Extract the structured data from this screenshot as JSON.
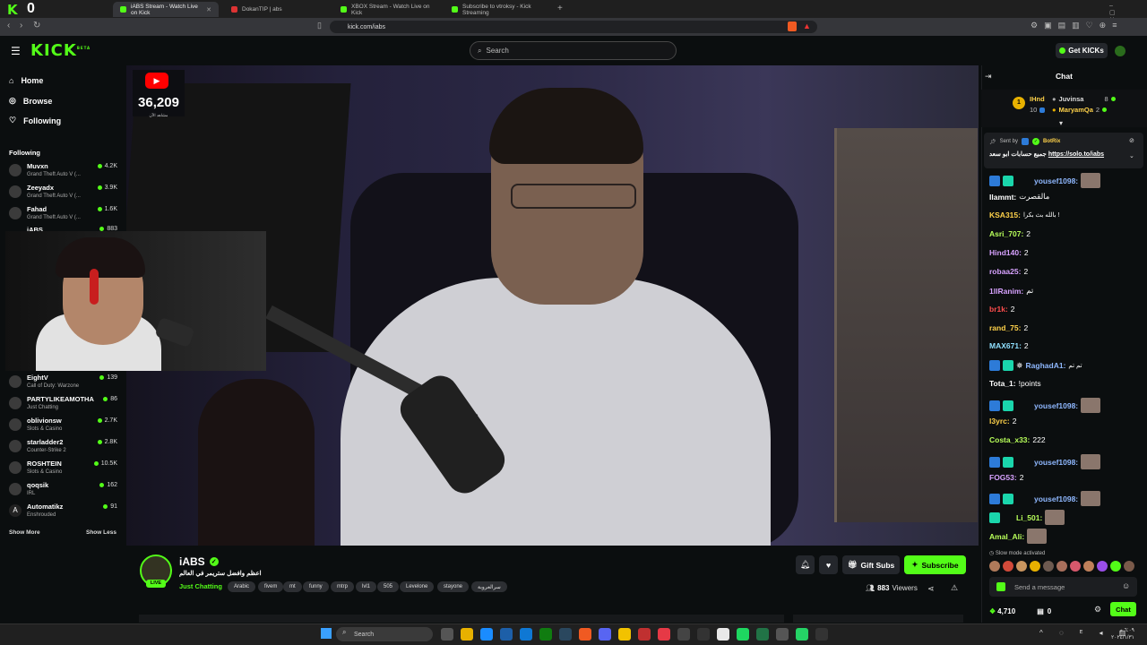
{
  "browser": {
    "tabs": [
      {
        "label": "iABS Stream - Watch Live on Kick"
      },
      {
        "label": "DokanTIP | abs"
      },
      {
        "label": "XBOX Stream - Watch Live on Kick"
      },
      {
        "label": "Subscribe to vtroksy - Kick Streaming"
      }
    ],
    "url": "kick.com/iabs"
  },
  "header": {
    "logo": "KICK",
    "logo_sup": "BETA",
    "search_placeholder": "Search",
    "get_kicks": "Get KICKs"
  },
  "sidebar": {
    "nav": [
      {
        "label": "Home",
        "icon": "home-icon"
      },
      {
        "label": "Browse",
        "icon": "compass-icon"
      },
      {
        "label": "Following",
        "icon": "heart-icon"
      }
    ],
    "following_title": "Following",
    "channels": [
      {
        "name": "Muvxn",
        "game": "Grand Theft Auto V (...",
        "viewers": "4.2K"
      },
      {
        "name": "Zeeyadx",
        "game": "Grand Theft Auto V (...",
        "viewers": "3.9K"
      },
      {
        "name": "Fahad",
        "game": "Grand Theft Auto V (...",
        "viewers": "1.6K"
      },
      {
        "name": "iABS",
        "game": "",
        "viewers": "883"
      },
      {
        "name": "EightV",
        "game": "Call of Duty: Warzone",
        "viewers": "139"
      },
      {
        "name": "PARTYLIKEAMOTHA",
        "game": "Just Chatting",
        "viewers": "86"
      },
      {
        "name": "oblivionsw",
        "game": "Slots & Casino",
        "viewers": "2.7K"
      },
      {
        "name": "starladder2",
        "game": "Counter-Strike 2",
        "viewers": "2.8K"
      },
      {
        "name": "ROSHTEIN",
        "game": "Slots & Casino",
        "viewers": "10.5K"
      },
      {
        "name": "qoqsik",
        "game": "IRL",
        "viewers": "162"
      },
      {
        "name": "Automatikz",
        "game": "Enshrouded",
        "viewers": "91"
      }
    ],
    "show_more": "Show More",
    "show_less": "Show Less"
  },
  "video": {
    "yt_count": "36,209",
    "yt_sub": "مشاهد الآن"
  },
  "stream_info": {
    "streamer": "iABS",
    "live": "LIVE",
    "title": "اعظم وافضل ستريمر في العالم",
    "category": "Just Chatting",
    "tags": [
      "Arabic",
      "fivem",
      "mt",
      "funny",
      "mtrp",
      "lvl1",
      "505",
      "Levelone",
      "stayone",
      "سرالعروبة"
    ],
    "gift_subs": "Gift Subs",
    "subscribe": "Subscribe",
    "viewers_count": "883",
    "viewers_label": "Viewers"
  },
  "chat": {
    "title": "Chat",
    "leaderboard": [
      {
        "rank": "1",
        "name": "IHnd",
        "count": "10"
      },
      {
        "name": "Juvinsa",
        "count": "8"
      },
      {
        "name": "MaryamQa",
        "count": "2"
      }
    ],
    "pinned": {
      "sent_by": "Sent by",
      "bot": "BotRix",
      "text": "جميع حسابات ابو سعد",
      "link": "https://solo.to/iabs"
    },
    "messages": [
      {
        "user": "yousef1098:",
        "text": "",
        "color": "#8fb8ff"
      },
      {
        "user": "Ilammt:",
        "text": "مالقصرت",
        "color": "#ffffff"
      },
      {
        "user": "KSA315:",
        "text": "بالله بث بكرا !",
        "color": "#ffd24a"
      },
      {
        "user": "Asri_707:",
        "text": "2",
        "color": "#b8ff5a"
      },
      {
        "user": "Hind140:",
        "text": "2",
        "color": "#d7a2ff"
      },
      {
        "user": "robaa25:",
        "text": "2",
        "color": "#d7a2ff"
      },
      {
        "user": "1llRanim:",
        "text": "تم",
        "color": "#d7a2ff"
      },
      {
        "user": "br1k:",
        "text": "2",
        "color": "#ff4d4d"
      },
      {
        "user": "rand_75:",
        "text": "2",
        "color": "#ffd24a"
      },
      {
        "user": "MAX671:",
        "text": "2",
        "color": "#8fe0ff"
      },
      {
        "user": "RaghadA1:",
        "text": "تم تم",
        "color": "#8fb8ff"
      },
      {
        "user": "Tota_1:",
        "text": "!points",
        "color": "#ffffff"
      },
      {
        "user": "yousef1098:",
        "text": "",
        "color": "#8fb8ff"
      },
      {
        "user": "l3yrc:",
        "text": "2",
        "color": "#ffd24a"
      },
      {
        "user": "Costa_x33:",
        "text": "222",
        "color": "#b8ff5a"
      },
      {
        "user": "yousef1098:",
        "text": "",
        "color": "#8fb8ff"
      },
      {
        "user": "FOG53:",
        "text": "2",
        "color": "#d7a2ff"
      },
      {
        "user": "yousef1098:",
        "text": "",
        "color": "#8fb8ff"
      },
      {
        "user": "Li_501:",
        "text": "",
        "color": "#b8ff5a"
      },
      {
        "user": "Amal_Ali:",
        "text": "",
        "color": "#b8ff5a"
      }
    ],
    "slow_mode": "Slow mode activated",
    "input_placeholder": "Send a message",
    "kicks": "4,710",
    "points": "0",
    "chat_button": "Chat"
  },
  "taskbar": {
    "search": "Search",
    "clock_time": "٦:٠٩ م",
    "clock_date": "٢٠٢٤/١/٣١"
  },
  "colors": {
    "brand": "#53fc18",
    "bg": "#0b0e0f"
  }
}
